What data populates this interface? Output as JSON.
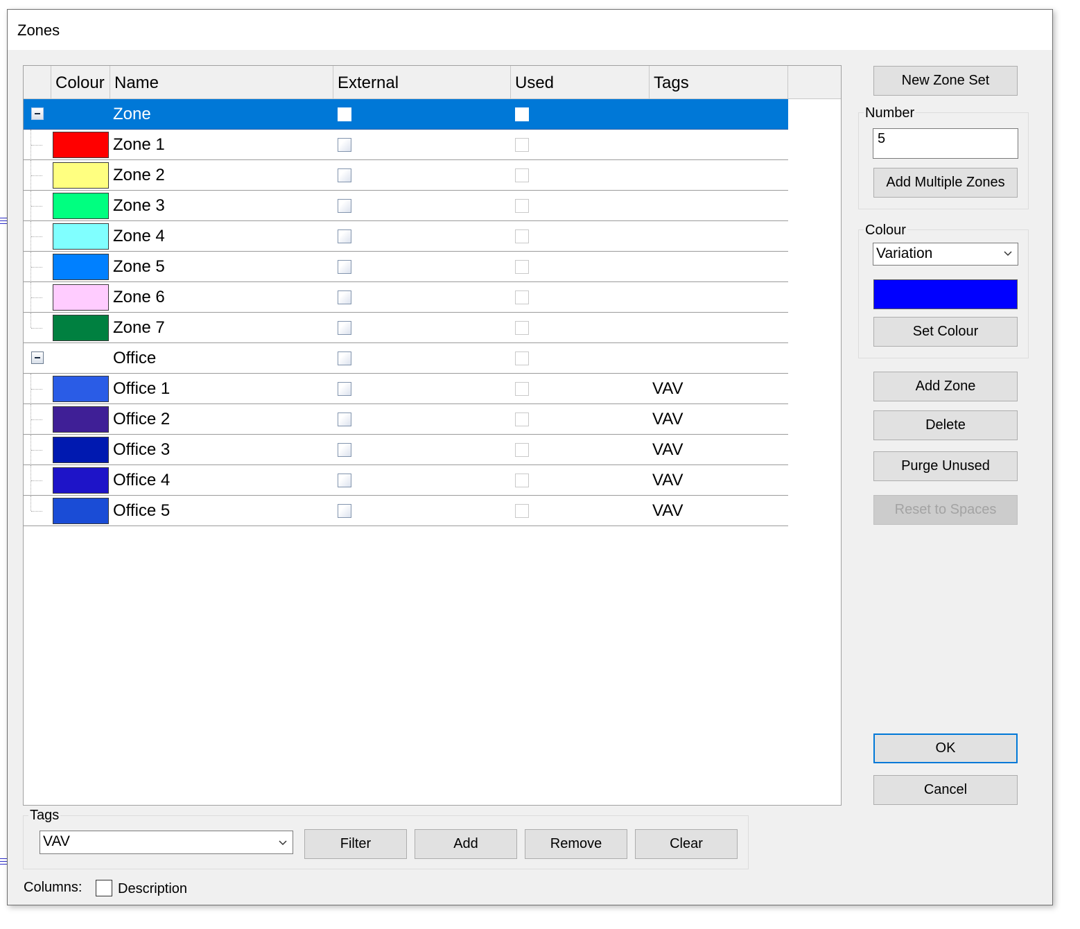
{
  "window": {
    "title": "Zones"
  },
  "grid": {
    "columns": [
      "Colour",
      "Name",
      "External",
      "Used",
      "Tags"
    ],
    "rows": [
      {
        "type": "group",
        "name": "Zone",
        "selected": true,
        "tags": ""
      },
      {
        "type": "item",
        "name": "Zone 1",
        "colour": "#ff0000",
        "tags": ""
      },
      {
        "type": "item",
        "name": "Zone 2",
        "colour": "#ffff80",
        "tags": ""
      },
      {
        "type": "item",
        "name": "Zone 3",
        "colour": "#00ff80",
        "tags": ""
      },
      {
        "type": "item",
        "name": "Zone 4",
        "colour": "#80ffff",
        "tags": ""
      },
      {
        "type": "item",
        "name": "Zone 5",
        "colour": "#0080ff",
        "tags": ""
      },
      {
        "type": "item",
        "name": "Zone 6",
        "colour": "#ffccff",
        "tags": ""
      },
      {
        "type": "item",
        "name": "Zone 7",
        "colour": "#008040",
        "tags": "",
        "last": true
      },
      {
        "type": "group",
        "name": "Office",
        "selected": false,
        "tags": ""
      },
      {
        "type": "item",
        "name": "Office 1",
        "colour": "#2a5ce6",
        "tags": "VAV"
      },
      {
        "type": "item",
        "name": "Office 2",
        "colour": "#3f1f96",
        "tags": "VAV"
      },
      {
        "type": "item",
        "name": "Office 3",
        "colour": "#0019b0",
        "tags": "VAV"
      },
      {
        "type": "item",
        "name": "Office 4",
        "colour": "#1e14c8",
        "tags": "VAV"
      },
      {
        "type": "item",
        "name": "Office 5",
        "colour": "#1a4cd6",
        "tags": "VAV",
        "last": true
      }
    ]
  },
  "sidebar": {
    "new_zone_set": "New Zone Set",
    "number_label": "Number",
    "number_value": "5",
    "add_multiple": "Add Multiple Zones",
    "colour_label": "Colour",
    "colour_mode": "Variation",
    "colour_value": "#0000ff",
    "set_colour": "Set Colour",
    "add_zone": "Add Zone",
    "delete": "Delete",
    "purge_unused": "Purge Unused",
    "reset_to_spaces": "Reset to Spaces",
    "ok": "OK",
    "cancel": "Cancel"
  },
  "tags": {
    "label": "Tags",
    "value": "VAV",
    "filter": "Filter",
    "add": "Add",
    "remove": "Remove",
    "clear": "Clear"
  },
  "columns_option": {
    "label": "Columns:",
    "description": "Description",
    "description_checked": false
  }
}
